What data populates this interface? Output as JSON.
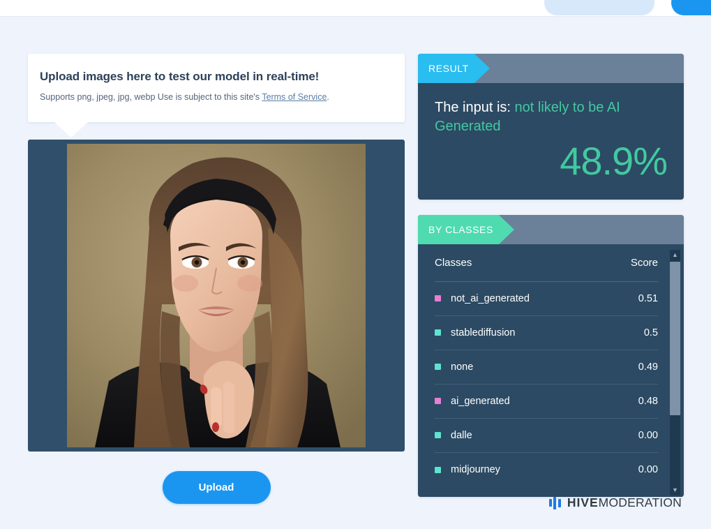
{
  "colors": {
    "page_background": "#eef3fc",
    "panel_body": "#2c4a63",
    "panel_header_band": "#6b8099",
    "result_tag": "#29bdf0",
    "byclasses_tag": "#4fdbaf",
    "accent_green": "#42c9a0",
    "primary_blue": "#1a96f0",
    "bullet_pink": "#e87ed6",
    "bullet_teal": "#5fe3d0",
    "logo_blue": "#1f7ae0"
  },
  "topbar": {
    "secondary_button_label": "",
    "primary_button_label": ""
  },
  "upload_card": {
    "title": "Upload images here to test our model in real-time!",
    "subtitle_prefix": "Supports png, jpeg, jpg, webp Use is subject to this site's ",
    "terms_link": "Terms of Service",
    "subtitle_suffix": "."
  },
  "preview": {
    "alt": "Portrait photo of a woman with long brown hair wearing a black headband and black top, hand resting under chin, tan studio backdrop"
  },
  "upload_button": {
    "label": "Upload"
  },
  "result": {
    "tag": "RESULT",
    "prefix": "The input is:",
    "verdict": "not likely to be AI Generated",
    "percent": "48.9%"
  },
  "by_classes": {
    "tag": "BY CLASSES",
    "columns": {
      "classes": "Classes",
      "score": "Score"
    },
    "rows": [
      {
        "name": "not_ai_generated",
        "score": "0.51",
        "color": "#e87ed6"
      },
      {
        "name": "stablediffusion",
        "score": "0.5",
        "color": "#5fe3d0"
      },
      {
        "name": "none",
        "score": "0.49",
        "color": "#5fe3d0"
      },
      {
        "name": "ai_generated",
        "score": "0.48",
        "color": "#e87ed6"
      },
      {
        "name": "dalle",
        "score": "0.00",
        "color": "#5fe3d0"
      },
      {
        "name": "midjourney",
        "score": "0.00",
        "color": "#5fe3d0"
      }
    ]
  },
  "footer": {
    "brand_bold": "HIVE",
    "brand_light": "MODERATION"
  }
}
